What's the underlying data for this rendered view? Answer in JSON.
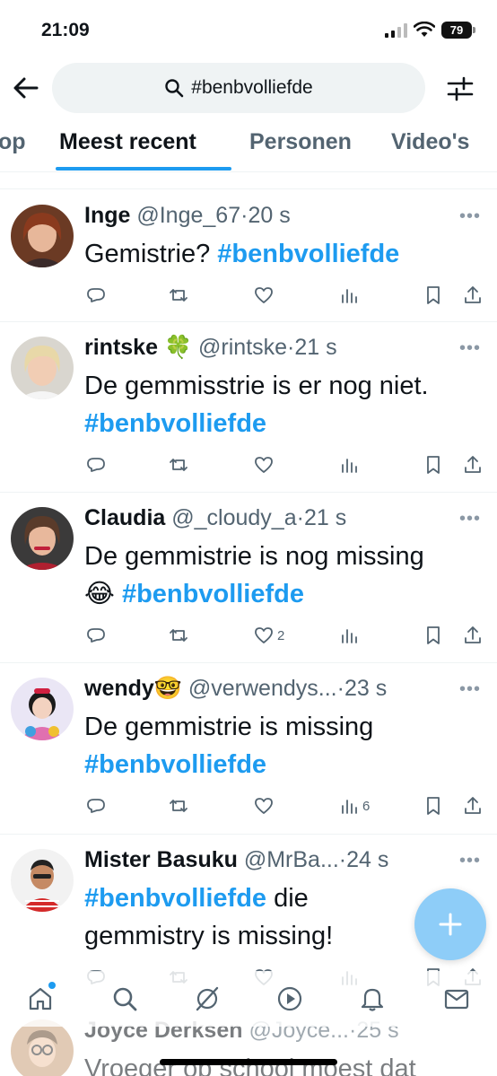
{
  "status": {
    "time": "21:09",
    "battery": "79"
  },
  "header": {
    "query": "#benbvolliefde"
  },
  "tabs": [
    "op",
    "Meest recent",
    "Personen",
    "Video's"
  ],
  "tweets": [
    {
      "name": "Inge",
      "handle": "@Inge_67",
      "sep": "·",
      "time": "20 s",
      "text": "Gemistrie? ",
      "tag": "#benbvolliefde",
      "likes": "",
      "views": ""
    },
    {
      "name": "rintske",
      "emoji": "🍀",
      "handle": "@rintske",
      "sep": "·",
      "time": "21 s",
      "text": "De gemmisstrie is er nog niet.",
      "tag": "#benbvolliefde",
      "likes": "",
      "views": ""
    },
    {
      "name": "Claudia",
      "handle": "@_cloudy_a",
      "sep": "·",
      "time": "21 s",
      "text": "De gemmistrie is nog missing",
      "emoji": "😂",
      "tag": "#benbvolliefde",
      "likes": "2",
      "views": ""
    },
    {
      "name": "wendy",
      "emoji": "🤓",
      "handle": "@verwendys...",
      "sep": "·",
      "time": "23 s",
      "text": "De gemmistrie is missing",
      "tag": "#benbvolliefde",
      "likes": "",
      "views": "6"
    },
    {
      "name": "Mister Basuku",
      "handle": "@MrBa...",
      "sep": "·",
      "time": "24 s",
      "tag": "#benbvolliefde",
      "text": " die",
      "text2": "gemmistry is missing!",
      "likes": "",
      "views": ""
    },
    {
      "name": "Joyce Derksen",
      "handle": "@Joyce...",
      "sep": "·",
      "time": "25 s",
      "text": "Vroeger op school moest dat"
    }
  ],
  "colors": {
    "accent": "#1d9bf0",
    "muted": "#536471",
    "fab": "#8ecdf8"
  },
  "icons": [
    "back-arrow-icon",
    "search-icon",
    "filter-icon",
    "reply-icon",
    "retweet-icon",
    "like-icon",
    "views-icon",
    "bookmark-icon",
    "share-icon",
    "home-icon",
    "explore-icon",
    "grok-icon",
    "video-icon",
    "notifications-icon",
    "messages-icon",
    "plus-icon"
  ]
}
